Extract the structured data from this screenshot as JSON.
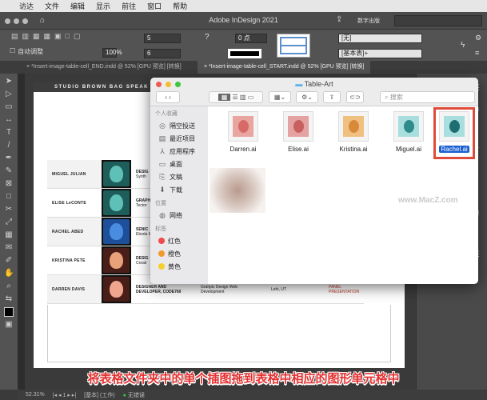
{
  "menubar": {
    "items": [
      "访达",
      "文件",
      "编辑",
      "显示",
      "前往",
      "窗口",
      "帮助"
    ]
  },
  "app": {
    "title": "Adobe InDesign 2021",
    "workspace": "数字出版"
  },
  "control": {
    "rows": "5",
    "cols": "6",
    "stroke": "0 点",
    "scale": "100%",
    "auto_adjust": "自动调整",
    "cell_style": "[无]",
    "table_style": "[基本表]+"
  },
  "tabs": [
    {
      "label": "*Insert-image-table-cell_END.indd @ 52% [GPU 预览] [转换]"
    },
    {
      "label": "*Insert-image-table-cell_START.indd @ 52% [GPU 预览] [转换]"
    }
  ],
  "right_panel": {
    "title": "跳跳"
  },
  "document": {
    "header": "STUDIO BROWN BAG SPEAK",
    "rows": [
      {
        "name": "MIGUEL JULIAN",
        "role": "DESIG",
        "sub": "Synth",
        "face": "#5fc0b8",
        "bg": "#1e5e5a"
      },
      {
        "name": "ELISE LeCONTE",
        "role": "GRAPH",
        "sub": "Tector",
        "face": "#5fc0b8",
        "bg": "#1e5e5a"
      },
      {
        "name": "RACHEL ABED",
        "role": "SENIC",
        "sub": "Eboda Moder",
        "face": "#4a8de0",
        "bg": "#1d4f9a"
      },
      {
        "name": "KRISTINA PETE",
        "role": "DESIG",
        "sub": "Creati",
        "face": "#e8a27a",
        "bg": "#4a1e18"
      },
      {
        "name": "DARREN DAVIS",
        "role": "DESIGNER AND DEVELOPER, CODE760",
        "sub": "",
        "face": "#f0a58e",
        "bg": "#4a1e18",
        "col3": "Grahpic Design Web Development",
        "col4": "Lehi, UT",
        "col5": "PANEL PRESENTATION"
      }
    ]
  },
  "finder": {
    "title": "Table-Art",
    "search_placeholder": "搜索",
    "sidebar": {
      "favorites_label": "个人收藏",
      "favorites": [
        "隔空投送",
        "最近项目",
        "应用程序",
        "桌面",
        "文稿",
        "下载"
      ],
      "locations_label": "位置",
      "locations": [
        "网络"
      ],
      "tags_label": "标签",
      "tags": [
        {
          "label": "红色",
          "color": "#ee4b4b"
        },
        {
          "label": "橙色",
          "color": "#f29a2e"
        },
        {
          "label": "黄色",
          "color": "#f5cf2e"
        }
      ]
    },
    "files": [
      {
        "name": "Darren.ai",
        "bg": "#e9a5a0",
        "face": "#d66a66"
      },
      {
        "name": "Elise.ai",
        "bg": "#e4a2a2",
        "face": "#c86060"
      },
      {
        "name": "Kristina.ai",
        "bg": "#f0c080",
        "face": "#d9893a"
      },
      {
        "name": "Miguel.ai",
        "bg": "#a8dede",
        "face": "#2f8a8a"
      },
      {
        "name": "Rachel.ai",
        "bg": "#a8dede",
        "face": "#1d6e70",
        "selected": true
      }
    ],
    "highlight_color": "#e04a3a"
  },
  "watermark": "www.MacZ.com",
  "caption": "将表格文件夹中的单个插图拖到表格中相应的图形单元格中",
  "status": {
    "zoom": "52.31%",
    "page": "1",
    "style": "[基本] (工作)",
    "preflight": "无错误"
  }
}
